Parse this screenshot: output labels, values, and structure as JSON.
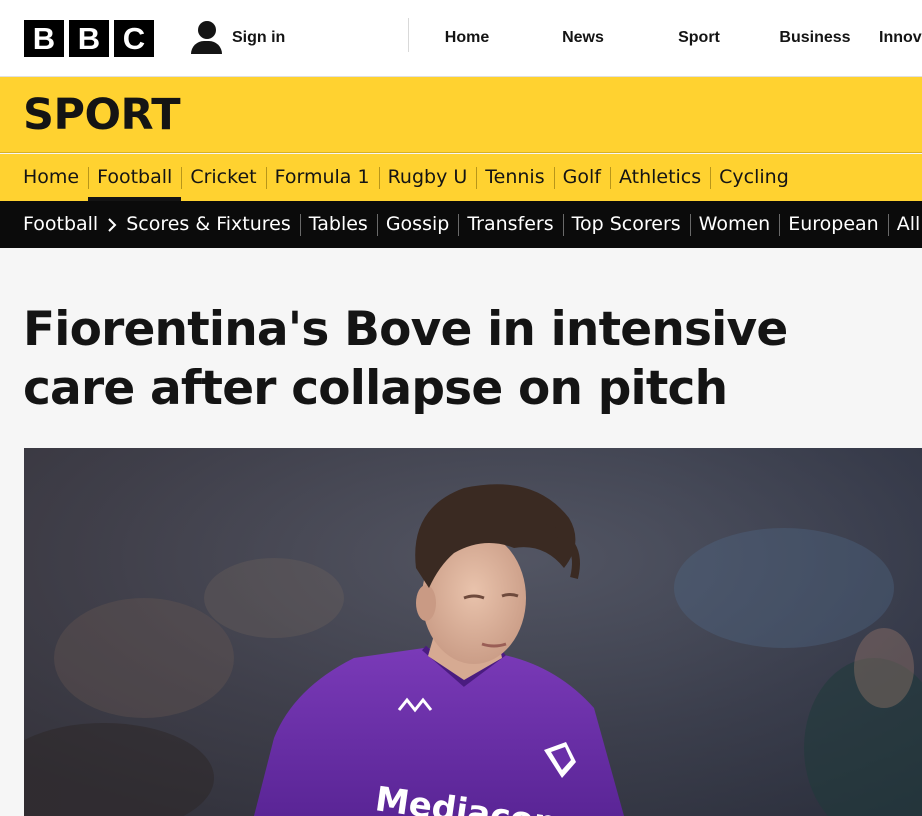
{
  "header": {
    "logo": [
      "B",
      "B",
      "C"
    ],
    "signin_label": "Sign in",
    "nav": [
      "Home",
      "News",
      "Sport",
      "Business",
      "Innovation"
    ]
  },
  "sport": {
    "title": "SPORT",
    "sections": [
      "Home",
      "Football",
      "Cricket",
      "Formula 1",
      "Rugby U",
      "Tennis",
      "Golf",
      "Athletics",
      "Cycling"
    ],
    "active_section": "Football"
  },
  "subnav": {
    "root": "Football",
    "items": [
      "Scores & Fixtures",
      "Tables",
      "Gossip",
      "Transfers",
      "Top Scorers",
      "Women",
      "European",
      "All"
    ]
  },
  "article": {
    "headline": "Fiorentina's Bove in intensive care after collapse on pitch",
    "image": {
      "shirt_brand": "Mediacom",
      "colors": {
        "kit": "#6a2fa8",
        "background": "#3b3a45"
      }
    }
  },
  "colors": {
    "sport_yellow": "#ffd230",
    "subnav_black": "#0b0b0b"
  }
}
